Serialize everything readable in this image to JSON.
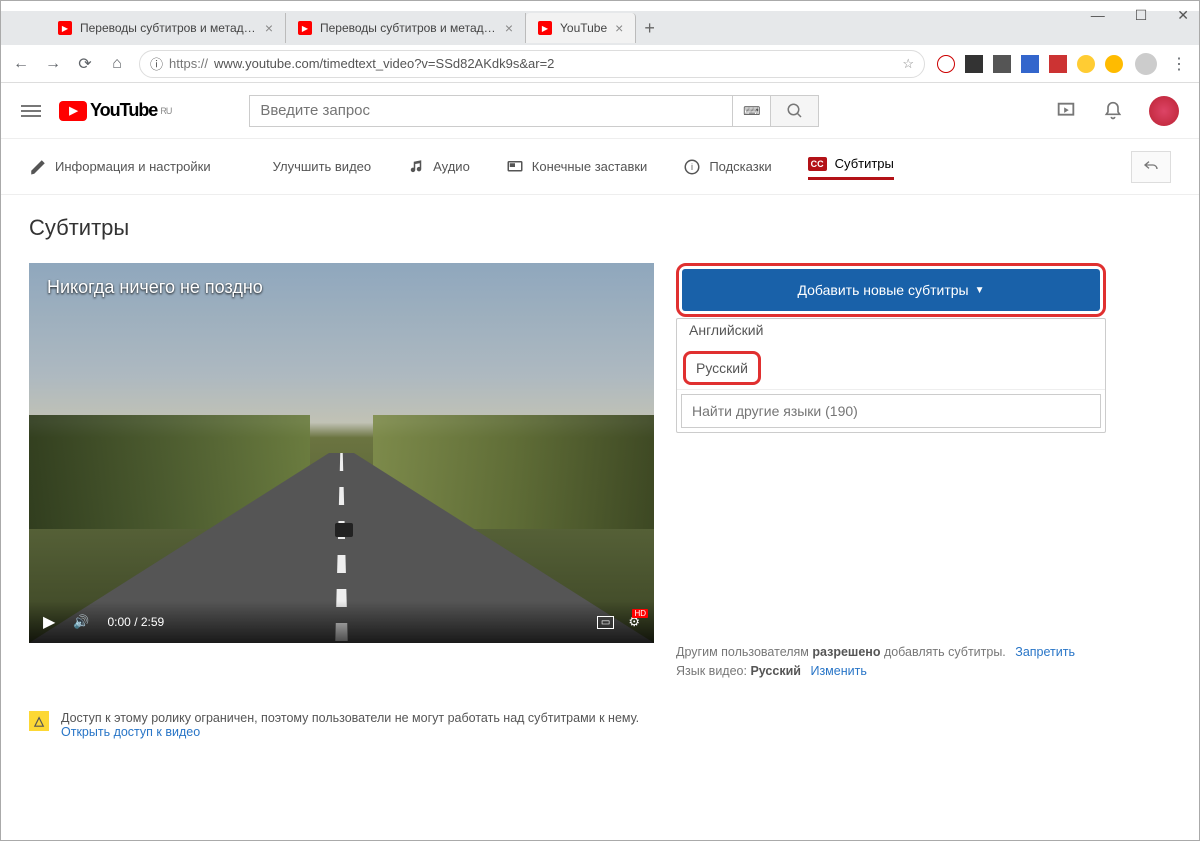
{
  "browser": {
    "tabs": [
      {
        "label": "Переводы субтитров и метадан…"
      },
      {
        "label": "Переводы субтитров и метадан…"
      },
      {
        "label": "YouTube"
      }
    ],
    "url_protocol": "https://",
    "url_rest": "www.youtube.com/timedtext_video?v=SSd82AKdk9s&ar=2"
  },
  "yt_header": {
    "brand": "YouTube",
    "region": "RU",
    "search_placeholder": "Введите запрос"
  },
  "studio_tabs": {
    "info": "Информация и настройки",
    "enhance": "Улучшить видео",
    "audio": "Аудио",
    "endscreens": "Конечные заставки",
    "cards": "Подсказки",
    "subtitles": "Субтитры"
  },
  "page": {
    "title": "Субтитры",
    "video_title": "Никогда ничего не поздно",
    "time": "0:00 / 2:59",
    "add_button": "Добавить новые субтитры",
    "languages": {
      "english": "Английский",
      "russian": "Русский",
      "search_placeholder": "Найти другие языки (190)"
    },
    "footer": {
      "line1_a": "Другим пользователям ",
      "line1_b": "разрешено",
      "line1_c": " добавлять субтитры.",
      "deny": "Запретить",
      "line2_a": "Язык видео: ",
      "line2_b": "Русский",
      "change": "Изменить"
    },
    "warning": {
      "text": "Доступ к этому ролику ограничен, поэтому пользователи не могут работать над субтитрами к нему.",
      "link": "Открыть доступ к видео"
    }
  }
}
